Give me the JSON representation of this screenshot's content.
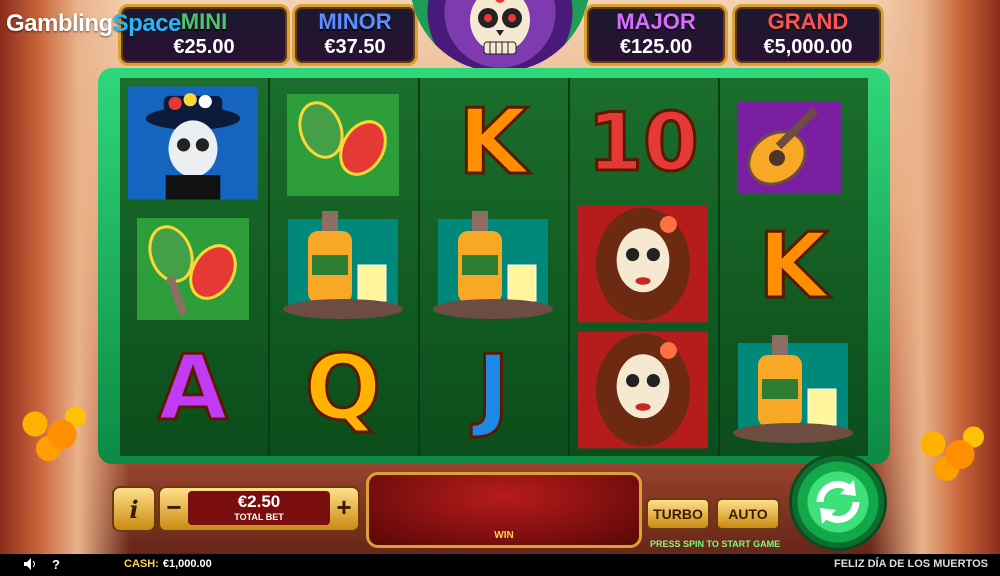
{
  "logo": {
    "part1": "Gambling",
    "part2": "Space"
  },
  "jackpots": [
    {
      "name": "MINI",
      "amount": "€25.00",
      "color": "#4fc36d"
    },
    {
      "name": "MINOR",
      "amount": "€37.50",
      "color": "#5b8dff"
    },
    {
      "name": "MAJOR",
      "amount": "€125.00",
      "color": "#d86cff"
    },
    {
      "name": "GRAND",
      "amount": "€5,000.00",
      "color": "#ff5252"
    }
  ],
  "reels": [
    [
      "man-wild-icon",
      "maracas-icon",
      "A"
    ],
    [
      "maracas-icon",
      "tequila-icon",
      "Q"
    ],
    [
      "K",
      "tequila-icon",
      "J"
    ],
    [
      "10",
      "catrina-icon",
      "catrina-icon"
    ],
    [
      "guitar-icon",
      "K",
      "tequila-icon"
    ]
  ],
  "controls": {
    "info": "i",
    "minus": "−",
    "bet_value": "€2.50",
    "bet_label": "TOTAL BET",
    "plus": "+",
    "win_label": "WIN",
    "turbo": "TURBO",
    "auto": "AUTO",
    "hint": "PRESS SPIN TO START GAME"
  },
  "bottom_bar": {
    "cash_label": "CASH:",
    "cash_value": "€1,000.00",
    "game_title": "FELIZ DÍA DE LOS MUERTOS",
    "help": "?"
  }
}
